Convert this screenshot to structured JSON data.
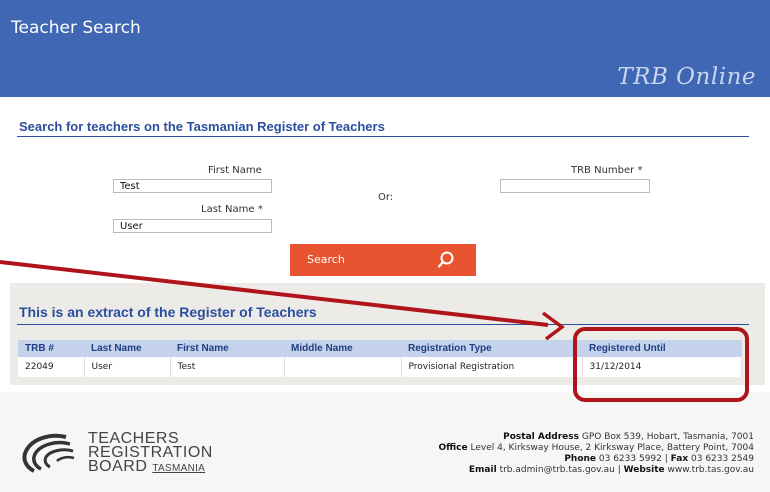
{
  "header": {
    "title": "Teacher Search",
    "brand": "TRB Online"
  },
  "search": {
    "heading": "Search for teachers on the Tasmanian Register of Teachers",
    "first_name_label": "First Name",
    "first_name_value": "Test",
    "last_name_label": "Last Name *",
    "last_name_value": "User",
    "or_label": "Or:",
    "trb_number_label": "TRB Number *",
    "trb_number_value": "",
    "button_label": "Search"
  },
  "register": {
    "heading": "This is an extract of the Register of Teachers",
    "columns": [
      "TRB #",
      "Last Name",
      "First Name",
      "Middle Name",
      "Registration Type",
      "Registered Until"
    ],
    "rows": [
      [
        "22049",
        "User",
        "Test",
        "",
        "Provisional Registration",
        "31/12/2014"
      ]
    ]
  },
  "footer": {
    "logo": {
      "line1": "TEACHERS",
      "line2": "REGISTRATION",
      "line3a": "BOARD",
      "line3b": "TASMANIA"
    },
    "postal_label": "Postal Address",
    "postal_value": "GPO Box 539, Hobart, Tasmania, 7001",
    "office_label": "Office",
    "office_value": "Level 4, Kirksway House, 2 Kirksway Place, Battery Point, 7004",
    "phone_label": "Phone",
    "phone_value": "03 6233 5992",
    "fax_label": "Fax",
    "fax_value": "03 6233 2549",
    "email_label": "Email",
    "email_value": "trb.admin@trb.tas.gov.au",
    "website_label": "Website",
    "website_value": "www.trb.tas.gov.au"
  },
  "colors": {
    "header": "#3f67b3",
    "accent": "#e8542f",
    "annotation": "#b0141b"
  }
}
